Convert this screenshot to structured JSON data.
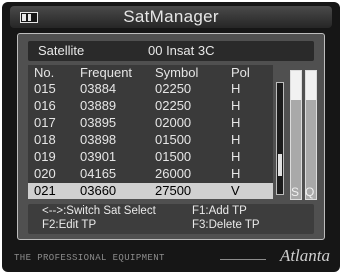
{
  "header": {
    "title": "SatManager",
    "icon": "tv-icon"
  },
  "satellite": {
    "label": "Satellite",
    "value": "00  Insat 3C"
  },
  "table": {
    "columns": [
      "No.",
      "Frequent",
      "Symbol",
      "Pol"
    ],
    "rows": [
      {
        "no": "015",
        "freq": "03884",
        "sym": "02250",
        "pol": "H"
      },
      {
        "no": "016",
        "freq": "03889",
        "sym": "02250",
        "pol": "H"
      },
      {
        "no": "017",
        "freq": "03895",
        "sym": "02000",
        "pol": "H"
      },
      {
        "no": "018",
        "freq": "03898",
        "sym": "01500",
        "pol": "H"
      },
      {
        "no": "019",
        "freq": "03901",
        "sym": "01500",
        "pol": "H"
      },
      {
        "no": "020",
        "freq": "04165",
        "sym": "26000",
        "pol": "H"
      },
      {
        "no": "021",
        "freq": "03660",
        "sym": "27500",
        "pol": "V"
      }
    ],
    "selected_index": 6,
    "scroll_position": 0.8
  },
  "signal": {
    "s_label": "S",
    "q_label": "Q",
    "strength_level": 0.23,
    "quality_level": 0.23
  },
  "help": {
    "switch": "<-->:Switch Sat Select",
    "add": "F1:Add TP",
    "edit": "F2:Edit TP",
    "delete": "F3:Delete TP"
  },
  "footer": {
    "tagline": "THE PROFESSIONAL EQUIPMENT",
    "brand": "Atlanta"
  },
  "colors": {
    "panel": "#505050",
    "selected_row": "#d0d0d0",
    "background": "#161616"
  }
}
